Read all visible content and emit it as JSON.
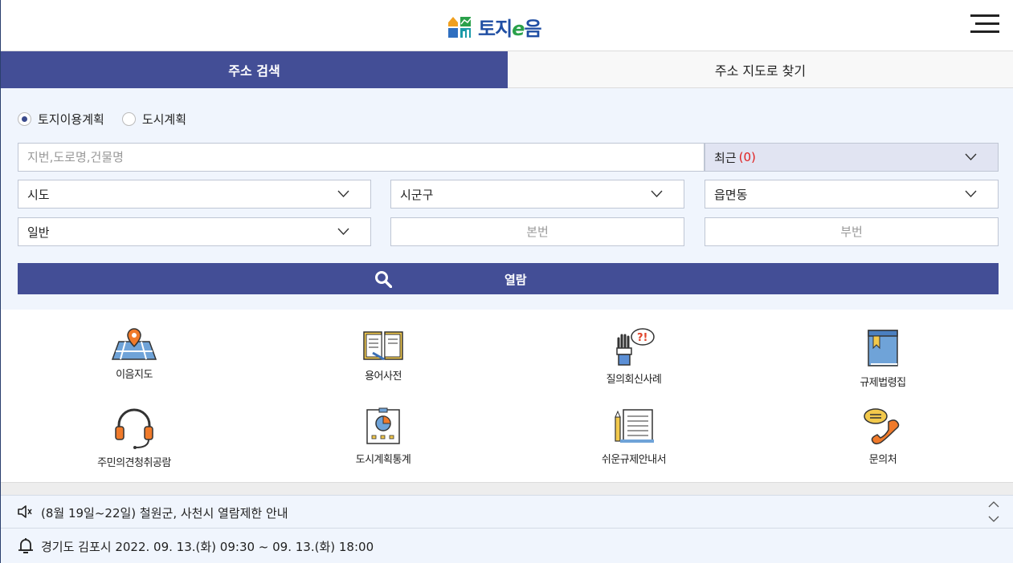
{
  "header": {
    "logo_text_main": "토지",
    "logo_text_e": "e",
    "logo_text_tail": "음"
  },
  "tabs": [
    {
      "label": "주소 검색",
      "active": true
    },
    {
      "label": "주소 지도로 찾기",
      "active": false
    }
  ],
  "search": {
    "radios": [
      {
        "label": "토지이용계획",
        "checked": true
      },
      {
        "label": "도시계획",
        "checked": false
      }
    ],
    "address_placeholder": "지번,도로명,건물명",
    "recent_label": "최근",
    "recent_count": "(0)",
    "sido": "시도",
    "sigungu": "시군구",
    "eupmyeondong": "읍면동",
    "land_type": "일반",
    "bonbeon_placeholder": "본번",
    "bubeon_placeholder": "부번",
    "view_button": "열람"
  },
  "quick_menu": [
    {
      "label": "이음지도",
      "icon": "map-pin-icon"
    },
    {
      "label": "용어사전",
      "icon": "dictionary-book-icon"
    },
    {
      "label": "질의회신사례",
      "icon": "question-hand-icon"
    },
    {
      "label": "규제법령집",
      "icon": "law-book-icon"
    },
    {
      "label": "주민의견청취공람",
      "icon": "headset-icon"
    },
    {
      "label": "도시계획통계",
      "icon": "statistics-chart-icon"
    },
    {
      "label": "쉬운규제안내서",
      "icon": "document-pencil-icon"
    },
    {
      "label": "문의처",
      "icon": "phone-chat-icon"
    }
  ],
  "notices": [
    {
      "text": "(8월 19일~22일) 철원군, 사천시 열람제한 안내",
      "icon": "speaker-icon"
    },
    {
      "text": "경기도 김포시 2022. 09. 13.(화) 09:30 ~ 09. 13.(화) 18:00",
      "icon": "bell-icon"
    }
  ],
  "colors": {
    "primary": "#434e96",
    "search_bg": "#f0f5fd",
    "recent_bg": "#e1e4f2",
    "recent_count": "#e02020"
  }
}
